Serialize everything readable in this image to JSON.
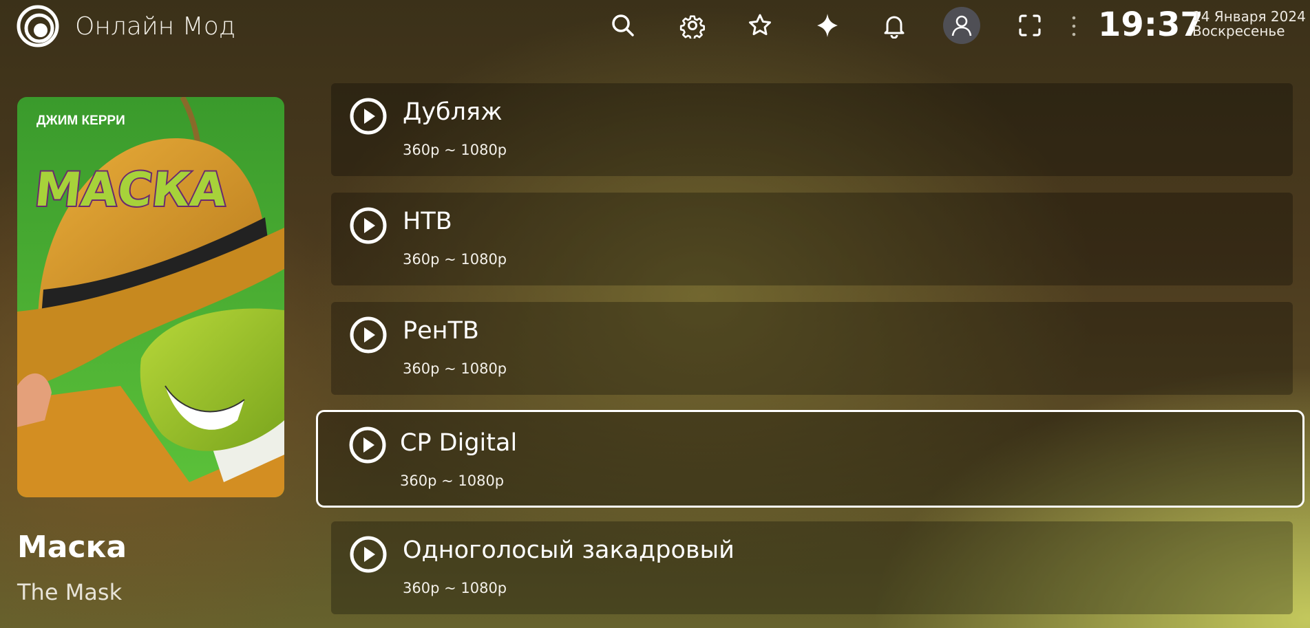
{
  "header": {
    "app_title": "Онлайн Мод",
    "icons": {
      "logo": "logo-icon",
      "search": "search-icon",
      "settings": "gear-icon",
      "favorites": "star-icon",
      "sparkle": "sparkle-icon",
      "notifications": "bell-icon",
      "profile": "user-icon",
      "fullscreen": "fullscreen-icon",
      "more": "vertical-dots-icon"
    },
    "time": "19:37",
    "date": "14 Января 2024",
    "weekday": "Воскресенье"
  },
  "movie": {
    "poster_actor": "ДЖИМ КЕРРИ",
    "poster_logo": "МАСКА",
    "title": "Маска",
    "original_title": "The Mask"
  },
  "sources": {
    "items": [
      {
        "label": "Дубляж",
        "quality": "360p ~ 1080p",
        "icon": "play-icon",
        "selected": false
      },
      {
        "label": "НТВ",
        "quality": "360p ~ 1080p",
        "icon": "play-icon",
        "selected": false
      },
      {
        "label": "РенТВ",
        "quality": "360p ~ 1080p",
        "icon": "play-icon",
        "selected": false
      },
      {
        "label": "CP Digital",
        "quality": "360p ~ 1080p",
        "icon": "play-icon",
        "selected": true
      },
      {
        "label": "Одноголосый закадровый",
        "quality": "360p ~ 1080p",
        "icon": "play-icon",
        "selected": false
      }
    ]
  },
  "colors": {
    "selection_border": "#ffffff",
    "poster_background": "#4caf2e",
    "hat": "#d99a2b",
    "mask_face": "#9ccc2a"
  }
}
